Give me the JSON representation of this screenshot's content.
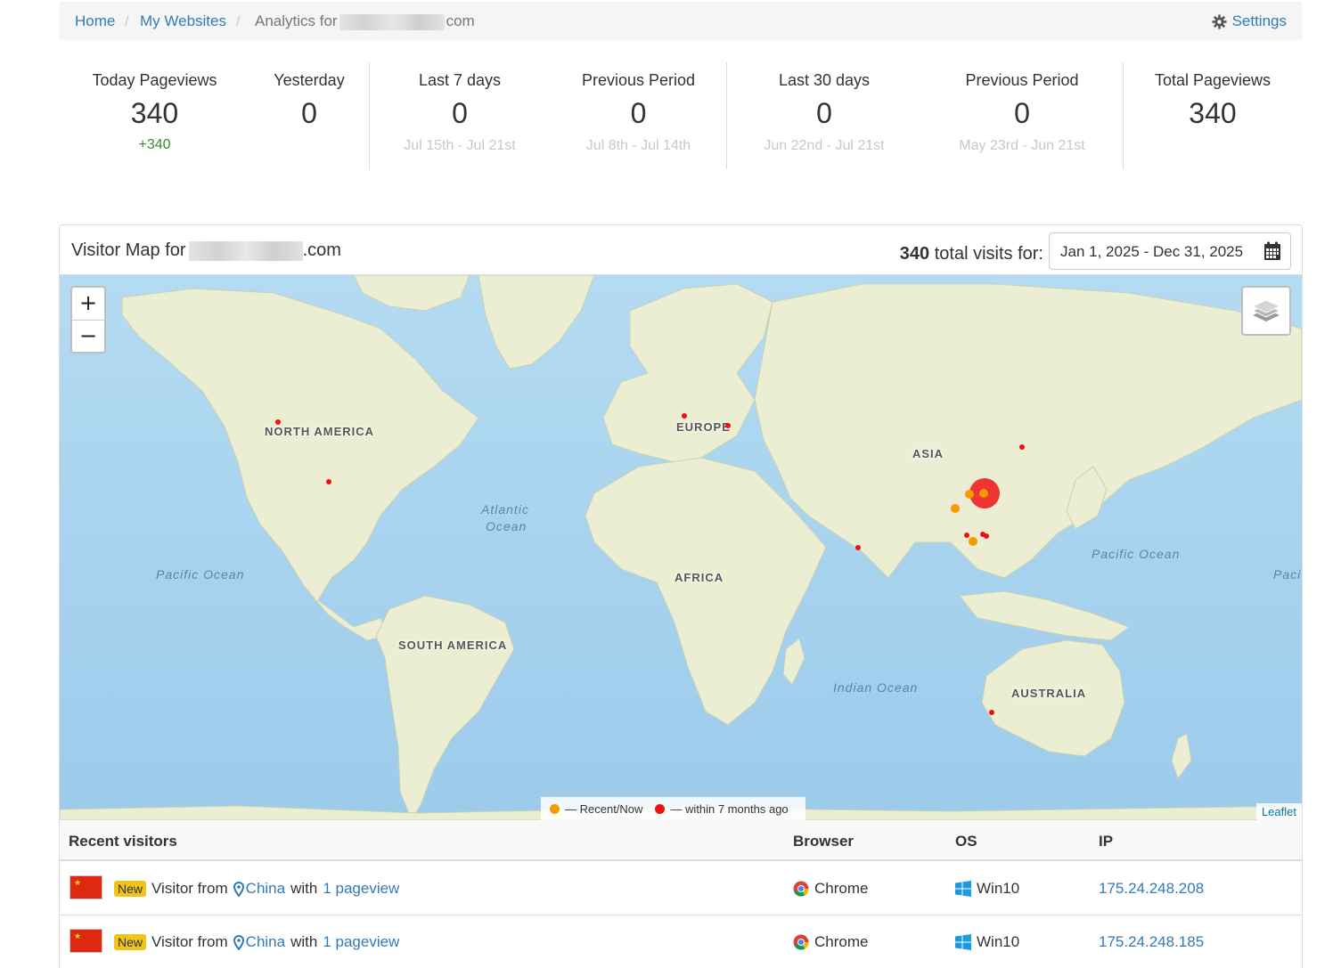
{
  "breadcrumb": {
    "home": "Home",
    "my_websites": "My Websites",
    "analytics_prefix": "Analytics for",
    "analytics_suffix": "com",
    "settings": "Settings"
  },
  "stats": [
    {
      "label": "Today Pageviews",
      "value": "340",
      "delta": "+340",
      "sub": ""
    },
    {
      "label": "Yesterday",
      "value": "0",
      "delta": "",
      "sub": ""
    },
    {
      "label": "Last 7 days",
      "value": "0",
      "delta": "",
      "sub": "Jul 15th - Jul 21st"
    },
    {
      "label": "Previous Period",
      "value": "0",
      "delta": "",
      "sub": "Jul 8th - Jul 14th"
    },
    {
      "label": "Last 30 days",
      "value": "0",
      "delta": "",
      "sub": "Jun 22nd - Jul 21st"
    },
    {
      "label": "Previous Period",
      "value": "0",
      "delta": "",
      "sub": "May 23rd - Jun 21st"
    },
    {
      "label": "Total Pageviews",
      "value": "340",
      "delta": "",
      "sub": ""
    }
  ],
  "map_panel": {
    "title_prefix": "Visitor Map for",
    "title_suffix": ".com",
    "visits_count": "340",
    "visits_text": "total visits for:",
    "date_range": "Jan 1, 2025 - Dec 31, 2025"
  },
  "map": {
    "zoom_in": "+",
    "zoom_out": "−",
    "labels": {
      "north_america": "NORTH AMERICA",
      "south_america": "SOUTH AMERICA",
      "europe": "EUROPE",
      "africa": "AFRICA",
      "asia": "ASIA",
      "australia": "AUSTRALIA"
    },
    "oceans": {
      "atlantic_1": "Atlantic",
      "atlantic_2": "Ocean",
      "pacific_west": "Pacific Ocean",
      "pacific_east": "Pacific Ocean",
      "pacific_edge": "Paci",
      "indian": "Indian Ocean"
    },
    "legend": {
      "recent": "— Recent/Now",
      "older": "— within 7 months ago"
    },
    "colors": {
      "recent": "#f59b00",
      "older": "#ee1111",
      "ocean": "#a8d4ef",
      "land": "#eef0d8"
    },
    "attribution": "Leaflet"
  },
  "table": {
    "headers": {
      "visitor": "Recent visitors",
      "browser": "Browser",
      "os": "OS",
      "ip": "IP"
    },
    "rows": [
      {
        "badge": "New",
        "text": "Visitor from",
        "country": "China",
        "with": "with",
        "pageviews": "1 pageview",
        "browser": "Chrome",
        "os": "Win10",
        "ip": "175.24.248.208"
      },
      {
        "badge": "New",
        "text": "Visitor from",
        "country": "China",
        "with": "with",
        "pageviews": "1 pageview",
        "browser": "Chrome",
        "os": "Win10",
        "ip": "175.24.248.185"
      }
    ]
  }
}
